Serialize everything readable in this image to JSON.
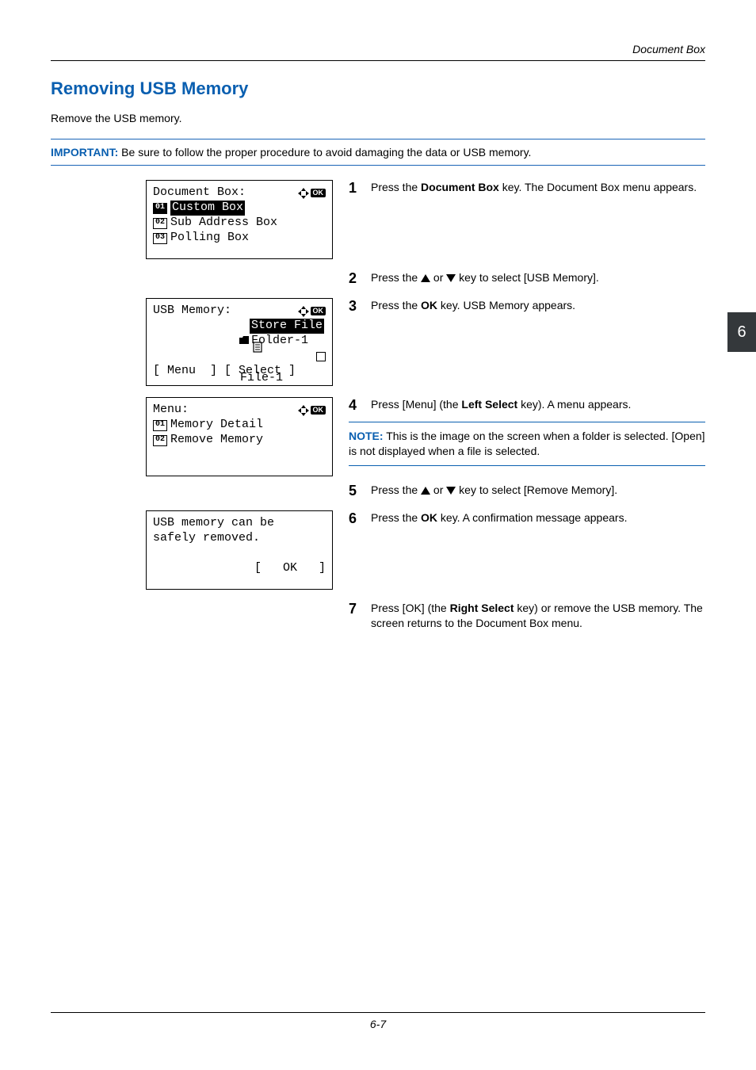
{
  "running_head": "Document Box",
  "section_title": "Removing USB Memory",
  "intro": "Remove the USB memory.",
  "important": {
    "label": "IMPORTANT:",
    "text": " Be sure to follow the proper procedure to avoid damaging the data or USB memory."
  },
  "lcd1": {
    "title": "Document Box:",
    "items": [
      {
        "num": "01",
        "label": "Custom Box",
        "selected": true
      },
      {
        "num": "02",
        "label": "Sub Address Box",
        "selected": false
      },
      {
        "num": "03",
        "label": "Polling Box",
        "selected": false
      }
    ]
  },
  "lcd2": {
    "title": "USB Memory:",
    "store_label": "Store File",
    "folder": "Folder-1",
    "file": "File-1",
    "softkeys": "[ Menu  ] [ Select ]"
  },
  "lcd3": {
    "title": "Menu:",
    "items": [
      {
        "num": "01",
        "label": "Memory Detail"
      },
      {
        "num": "02",
        "label": "Remove Memory"
      }
    ]
  },
  "lcd4": {
    "line1": "USB memory can be",
    "line2": "safely removed.",
    "softkey": "[   OK   ]"
  },
  "steps": {
    "s1": {
      "num": "1",
      "pre": "Press the ",
      "bold": "Document Box",
      "post": " key. The Document Box menu appears."
    },
    "s2": {
      "num": "2",
      "pre": "Press the ",
      "post": " key to select [USB Memory].",
      "or": " or "
    },
    "s3": {
      "num": "3",
      "pre": "Press the ",
      "bold": "OK",
      "post": " key. USB Memory appears."
    },
    "s4": {
      "num": "4",
      "pre": "Press [Menu] (the ",
      "bold": "Left Select",
      "post": " key). A menu appears."
    },
    "s5": {
      "num": "5",
      "pre": "Press the ",
      "post": " key to select [Remove Memory].",
      "or": " or "
    },
    "s6": {
      "num": "6",
      "pre": "Press the ",
      "bold": "OK",
      "post": " key. A confirmation message appears."
    },
    "s7": {
      "num": "7",
      "pre": "Press [OK] (the ",
      "bold": "Right Select",
      "post": " key) or remove the USB memory. The screen returns to the Document Box menu."
    }
  },
  "note": {
    "label": "NOTE:",
    "text": " This is the image on the screen when a folder is selected. [Open] is not displayed when a file is selected."
  },
  "side_tab": "6",
  "page_number": "6-7"
}
